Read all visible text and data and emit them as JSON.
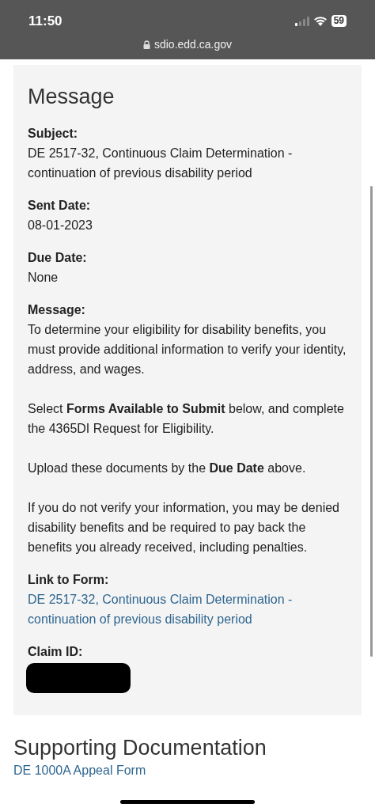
{
  "status_bar": {
    "time": "11:50",
    "battery": "59",
    "url": "sdio.edd.ca.gov"
  },
  "message": {
    "title": "Message",
    "fields": [
      {
        "label": "Subject:",
        "value": "DE 2517-32, Continuous Claim Determination - continuation of previous disability period",
        "kind": "text"
      },
      {
        "label": "Sent Date:",
        "value": "08-01-2023",
        "kind": "text"
      },
      {
        "label": "Due Date:",
        "value": "None",
        "kind": "text"
      },
      {
        "label": "Message:",
        "paragraphs": [
          "To determine your eligibility for disability benefits, you must provide additional information to verify your identity, address, and wages.",
          "Select **Forms Available to Submit** below, and complete the 4365DI Request for Eligibility.",
          "Upload these documents by the **Due Date** above.",
          "If you do not verify your information, you may be denied disability benefits and be required to pay back the benefits you already received, including penalties."
        ],
        "kind": "paragraphs"
      },
      {
        "label": "Link to Form:",
        "value": "DE 2517-32, Continuous Claim Determination - continuation of previous disability period",
        "kind": "link"
      },
      {
        "label": "Claim ID:",
        "kind": "redacted"
      }
    ]
  },
  "supporting": {
    "title": "Supporting Documentation",
    "links": [
      "DE 1000A Appeal Form"
    ]
  }
}
